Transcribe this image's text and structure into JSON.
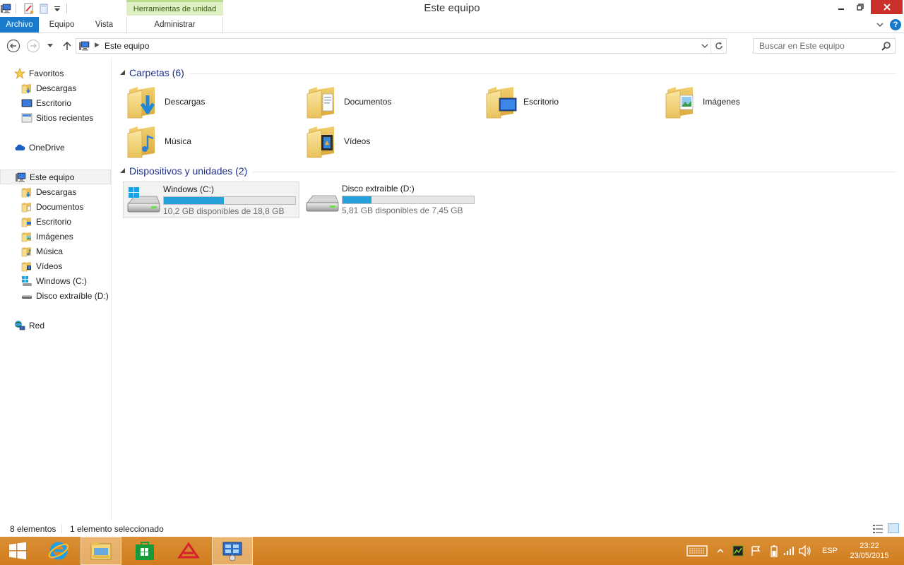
{
  "window": {
    "title": "Este equipo",
    "context_group": "Herramientas de unidad"
  },
  "ribbon": {
    "tabs": [
      "Archivo",
      "Equipo",
      "Vista",
      "Administrar"
    ]
  },
  "address": {
    "path": "Este equipo",
    "search_placeholder": "Buscar en Este equipo"
  },
  "nav": {
    "favorites": "Favoritos",
    "favorites_items": [
      "Descargas",
      "Escritorio",
      "Sitios recientes"
    ],
    "onedrive": "OneDrive",
    "thispc": "Este equipo",
    "thispc_items": [
      "Descargas",
      "Documentos",
      "Escritorio",
      "Imágenes",
      "Música",
      "Vídeos",
      "Windows (C:)",
      "Disco extraíble (D:)"
    ],
    "network": "Red"
  },
  "content": {
    "folders_header": "Carpetas (6)",
    "folders": [
      "Descargas",
      "Documentos",
      "Escritorio",
      "Imágenes",
      "Música",
      "Vídeos"
    ],
    "devices_header": "Dispositivos y unidades (2)",
    "drives": [
      {
        "name": "Windows (C:)",
        "free_text": "10,2 GB disponibles de 18,8 GB",
        "used_fraction": 0.457
      },
      {
        "name": "Disco extraíble (D:)",
        "free_text": "5,81 GB disponibles de 7,45 GB",
        "used_fraction": 0.22
      }
    ]
  },
  "status": {
    "count": "8 elementos",
    "selected": "1 elemento seleccionado"
  },
  "taskbar": {
    "language": "ESP",
    "time": "23:22",
    "date": "23/05/2015"
  },
  "colors": {
    "accent": "#1979ca",
    "drive_bar": "#26a0da",
    "taskbar": "#d98a2b",
    "group_header": "#1e3287",
    "context_tab": "#dff0c4"
  }
}
